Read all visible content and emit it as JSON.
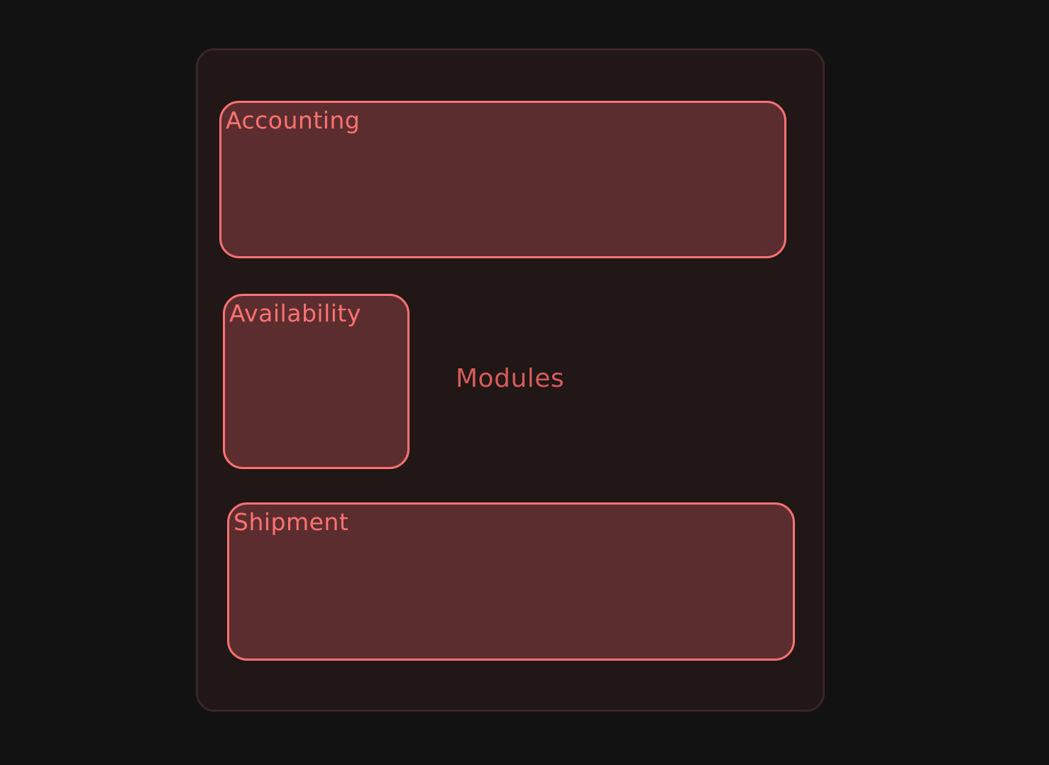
{
  "diagram": {
    "container": {
      "label": "Modules"
    },
    "modules": [
      {
        "id": "accounting",
        "label": "Accounting"
      },
      {
        "id": "availability",
        "label": "Availability"
      },
      {
        "id": "shipment",
        "label": "Shipment"
      }
    ],
    "colors": {
      "background": "#121212",
      "container_fill": "#201716",
      "container_stroke": "#3b2525",
      "module_fill": "#5c2d2e",
      "module_stroke": "#ff7273",
      "module_text": "#ff7273",
      "container_text": "#d85b5c"
    }
  }
}
